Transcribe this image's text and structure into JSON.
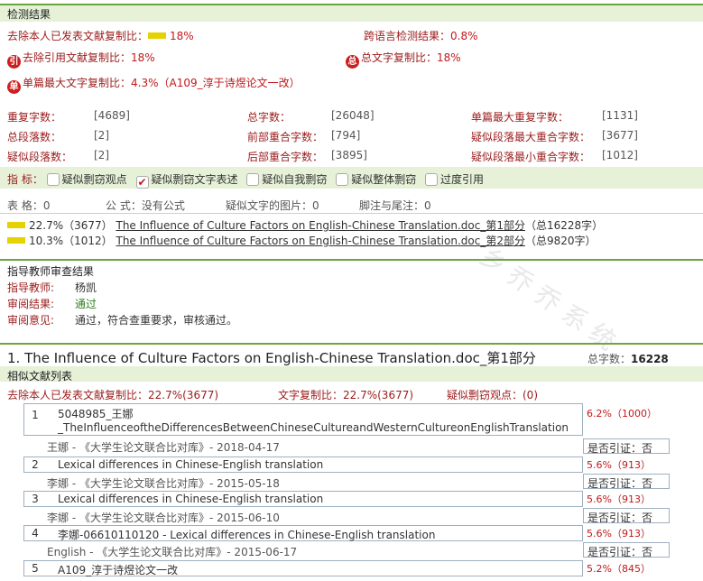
{
  "watermark": "乡 乔 乔 系 统",
  "detection": {
    "header": "检测结果",
    "excl_label": "去除本人已发表文献复制比：",
    "excl_value": "18%",
    "cross_label": "跨语言检测结果：",
    "cross_value": "0.8%",
    "icon_quote": "引",
    "quote_label": "去除引用文献复制比：",
    "quote_value": "18%",
    "icon_total": "总",
    "total_label": "总文字复制比：",
    "total_value": "18%",
    "icon_single": "单",
    "single_label": "单篇最大文字复制比：",
    "single_value": "4.3%（A109_淳于诗煜论文一改）"
  },
  "stats": [
    {
      "label": "重复字数：",
      "value": "[4689]"
    },
    {
      "label": "总字数：",
      "value": "[26048]"
    },
    {
      "label": "单篇最大重复字数：",
      "value": "[1131]"
    },
    {
      "label": "总段落数：",
      "value": "[2]"
    },
    {
      "label": "前部重合字数：",
      "value": "[794]"
    },
    {
      "label": "疑似段落最大重合字数：",
      "value": "[3677]"
    },
    {
      "label": "疑似段落数：",
      "value": "[2]"
    },
    {
      "label": "后部重合字数：",
      "value": "[3895]"
    },
    {
      "label": "疑似段落最小重合字数：",
      "value": "[1012]"
    }
  ],
  "indicators": {
    "label": "指  标：",
    "items": [
      {
        "text": "疑似剽窃观点",
        "checked": false
      },
      {
        "text": "疑似剽窃文字表述",
        "checked": true
      },
      {
        "text": "疑似自我剽窃",
        "checked": false
      },
      {
        "text": "疑似整体剽窃",
        "checked": false
      },
      {
        "text": "过度引用",
        "checked": false
      }
    ]
  },
  "meta_row": {
    "tables": "表  格：0",
    "formulas": "公  式：没有公式",
    "images": "疑似文字的图片：0",
    "footnotes": "脚注与尾注：0"
  },
  "parts": [
    {
      "pct": "22.7%（3677）",
      "title": "The Influence of Culture Factors on English-Chinese Translation.doc_第1部分",
      "count": "（总16228字）"
    },
    {
      "pct": "10.3%（1012）",
      "title": "The Influence of Culture Factors on English-Chinese Translation.doc_第2部分",
      "count": "（总9820字）"
    }
  ],
  "review": {
    "header": "指导教师审查结果",
    "teacher_label": "指导教师:",
    "teacher": "杨凯",
    "result_label": "审阅结果:",
    "result": "通过",
    "opinion_label": "审阅意见:",
    "opinion": "通过，符合查重要求，审核通过。"
  },
  "section": {
    "title": "1. The Influence of Culture Factors on English-Chinese Translation.doc_第1部分",
    "total_label": "总字数：",
    "total_value": "16228",
    "list_header": "相似文献列表",
    "excl": "去除本人已发表文献复制比：22.7%(3677)",
    "text_copy": "文字复制比：22.7%(3677)",
    "suspect": "疑似剽窃观点：(0)"
  },
  "docs": [
    {
      "n": "1",
      "title1": "5048985_王娜",
      "title2": "_TheInfluenceoftheDifferencesBetweenChineseCultureandWesternCultureonEnglishTranslation",
      "source": "王娜 - 《大学生论文联合比对库》- 2018-04-17",
      "pct": "6.2%（1000）",
      "cite": "是否引证：否"
    },
    {
      "n": "2",
      "title1": "Lexical differences in Chinese-English translation",
      "source": "李娜 - 《大学生论文联合比对库》- 2015-05-18",
      "pct": "5.6%（913）",
      "cite": "是否引证：否"
    },
    {
      "n": "3",
      "title1": "Lexical differences in Chinese-English translation",
      "source": "李娜 - 《大学生论文联合比对库》- 2015-06-10",
      "pct": "5.6%（913）",
      "cite": "是否引证：否"
    },
    {
      "n": "4",
      "title1": "李娜-06610110120 - Lexical differences in Chinese-English translation",
      "source": "English - 《大学生论文联合比对库》- 2015-06-17",
      "pct": "5.6%（913）",
      "cite": "是否引证：否"
    },
    {
      "n": "5",
      "title1": "A109_淳于诗煜论文一改",
      "pct": "5.2%（845）"
    }
  ]
}
